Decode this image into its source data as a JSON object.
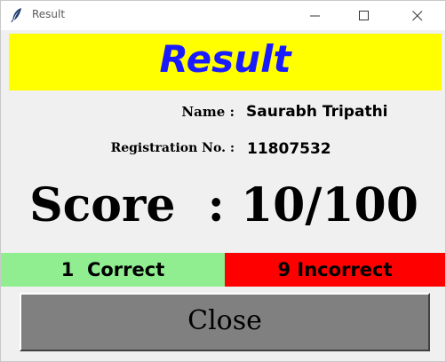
{
  "window": {
    "title": "Result"
  },
  "banner": {
    "text": "Result",
    "background": "#ffff00",
    "text_color": "#1a1aff"
  },
  "student": {
    "name_label": "Name :",
    "name_value": "Saurabh Tripathi",
    "reg_label": "Registration No. :",
    "reg_value": "11807532"
  },
  "score": {
    "label": "Score  : 10/100",
    "value": 10,
    "max": 100
  },
  "results": {
    "correct_text": "1  Correct",
    "correct_count": 1,
    "correct_color": "#90ee90",
    "incorrect_text": "9 Incorrect",
    "incorrect_count": 9,
    "incorrect_color": "#ff0000"
  },
  "actions": {
    "close_label": "Close"
  },
  "icons": {
    "app": "feather-icon",
    "minimize": "minimize-icon",
    "maximize": "maximize-icon",
    "close": "close-icon"
  }
}
